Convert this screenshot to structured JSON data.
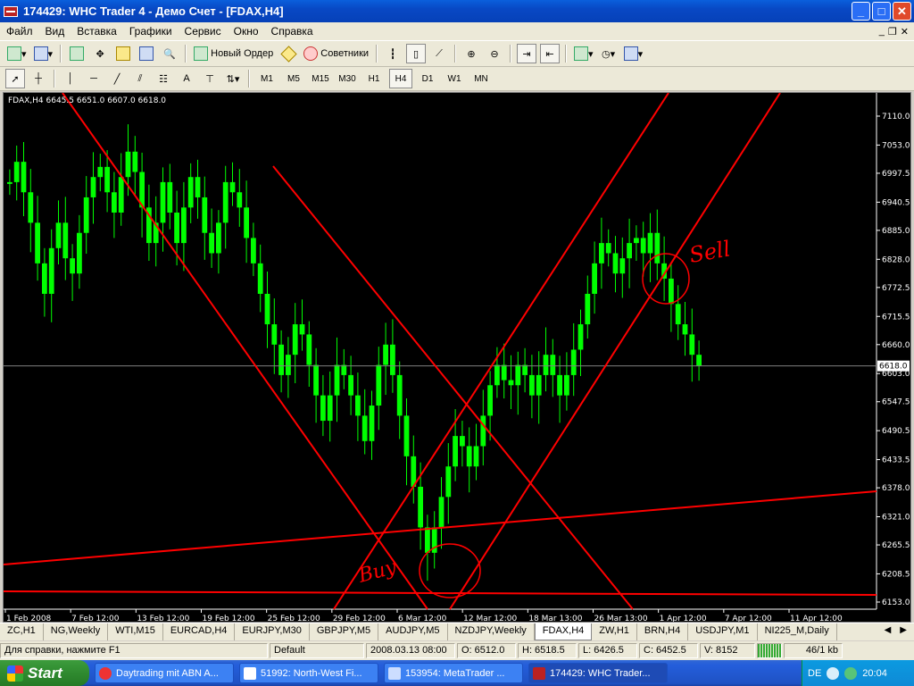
{
  "window": {
    "title": "174429: WHC Trader 4 - Демо Счет - [FDAX,H4]",
    "buttons": [
      "_",
      "□",
      "✕"
    ]
  },
  "menu": {
    "items": [
      "Файл",
      "Вид",
      "Вставка",
      "Графики",
      "Сервис",
      "Окно",
      "Справка"
    ]
  },
  "toolbar1": {
    "new_order_label": "Новый Ордер",
    "advisors_label": "Советники"
  },
  "toolbar2": {
    "timeframes": [
      "M1",
      "M5",
      "M15",
      "M30",
      "H1",
      "H4",
      "D1",
      "W1",
      "MN"
    ],
    "active_timeframe": "H4"
  },
  "chart": {
    "header": "FDAX,H4  6645.5 6651.0 6607.0 6618.0",
    "current_price_label": "6618.0",
    "annotations": [
      "Buy",
      "Sell"
    ],
    "colors": {
      "background": "#000000",
      "candles": "#00ff00",
      "lines": "#ff0000",
      "current_line": "#808080"
    }
  },
  "chart_data": {
    "type": "candlestick",
    "symbol": "FDAX",
    "timeframe": "H4",
    "last_bar": {
      "open": 6645.5,
      "high": 6651.0,
      "low": 6607.0,
      "close": 6618.0
    },
    "y_ticks": [
      "7110.0",
      "7053.0",
      "6997.5",
      "6940.5",
      "6885.0",
      "6828.0",
      "6772.5",
      "6715.5",
      "6660.0",
      "6603.0",
      "6547.5",
      "6490.5",
      "6433.5",
      "6378.0",
      "6321.0",
      "6265.5",
      "6208.5",
      "6153.0"
    ],
    "x_ticks": [
      "1 Feb 2008",
      "7 Feb 12:00",
      "13 Feb 12:00",
      "19 Feb 12:00",
      "25 Feb 12:00",
      "29 Feb 12:00",
      "6 Mar 12:00",
      "12 Mar 12:00",
      "18 Mar 13:00",
      "26 Mar 13:00",
      "1 Apr 12:00",
      "7 Apr 12:00",
      "11 Apr 12:00"
    ],
    "ylim": [
      6153.0,
      7110.0
    ],
    "closes": [
      6980,
      7020,
      6960,
      6900,
      6820,
      6760,
      6850,
      6900,
      6830,
      6800,
      6880,
      6950,
      6990,
      7010,
      6960,
      6920,
      6990,
      7040,
      7000,
      6930,
      6860,
      6900,
      6980,
      6920,
      6860,
      6930,
      6990,
      6950,
      6880,
      6840,
      6900,
      6980,
      6960,
      6930,
      6870,
      6820,
      6760,
      6700,
      6660,
      6600,
      6640,
      6700,
      6680,
      6620,
      6560,
      6510,
      6560,
      6620,
      6600,
      6560,
      6520,
      6470,
      6540,
      6620,
      6660,
      6600,
      6520,
      6440,
      6380,
      6300,
      6250,
      6300,
      6360,
      6420,
      6480,
      6460,
      6420,
      6460,
      6520,
      6580,
      6620,
      6590,
      6580,
      6620,
      6600,
      6560,
      6600,
      6640,
      6600,
      6560,
      6600,
      6650,
      6700,
      6760,
      6820,
      6860,
      6840,
      6800,
      6830,
      6860,
      6870,
      6840,
      6880,
      6820,
      6790,
      6740,
      6700,
      6680,
      6640,
      6618
    ]
  },
  "tabs": {
    "items": [
      "ZC,H1",
      "NG,Weekly",
      "WTI,M15",
      "EURCAD,H4",
      "EURJPY,M30",
      "GBPJPY,M5",
      "AUDJPY,M5",
      "NZDJPY,Weekly",
      "FDAX,H4",
      "ZW,H1",
      "BRN,H4",
      "USDJPY,M1",
      "NI225_M,Daily"
    ],
    "active": "FDAX,H4"
  },
  "status": {
    "help": "Для справки, нажмите F1",
    "profile": "Default",
    "datetime": "2008.03.13 08:00",
    "open": "O: 6512.0",
    "high": "H: 6518.5",
    "low": "L: 6426.5",
    "close": "C: 6452.5",
    "volume": "V: 8152",
    "traffic": "46/1 kb"
  },
  "taskbar": {
    "start_label": "Start",
    "tasks": [
      "Daytrading mit ABN A...",
      "51992: North-West Fi...",
      "153954: MetaTrader ...",
      "174429: WHC Trader..."
    ],
    "lang": "DE",
    "clock": "20:04"
  }
}
